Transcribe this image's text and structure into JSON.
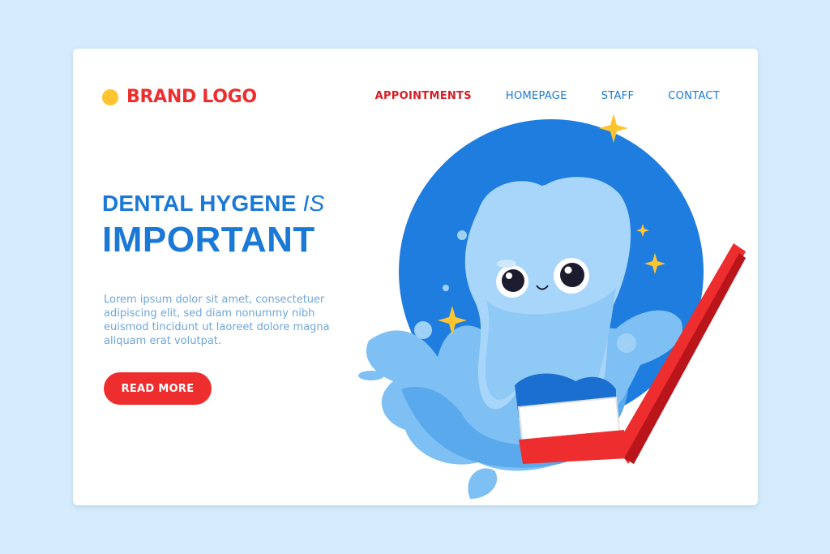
{
  "brand": {
    "name": "BRAND LOGO",
    "dot_color": "#ffc531",
    "color": "#ee2e2e"
  },
  "nav": {
    "items": [
      {
        "label": "APPOINTMENTS",
        "active": true
      },
      {
        "label": "HOMEPAGE",
        "active": false
      },
      {
        "label": "STAFF",
        "active": false
      },
      {
        "label": "CONTACT",
        "active": false
      }
    ]
  },
  "hero": {
    "title_line1": "DENTAL HYGENE",
    "title_line1_suffix": "IS",
    "title_line2": "IMPORTANT",
    "body": "Lorem ipsum dolor sit amet, consectetuer adipiscing elit, sed diam nonummy nibh euismod tincidunt ut laoreet dolore magna aliquam erat volutpat.",
    "cta_label": "READ MORE"
  },
  "colors": {
    "accent_blue": "#1a78d6",
    "accent_red": "#ee2e2e",
    "background": "#d5ebfb"
  },
  "illustration": {
    "subject": "tooth-character-with-toothbrush"
  }
}
